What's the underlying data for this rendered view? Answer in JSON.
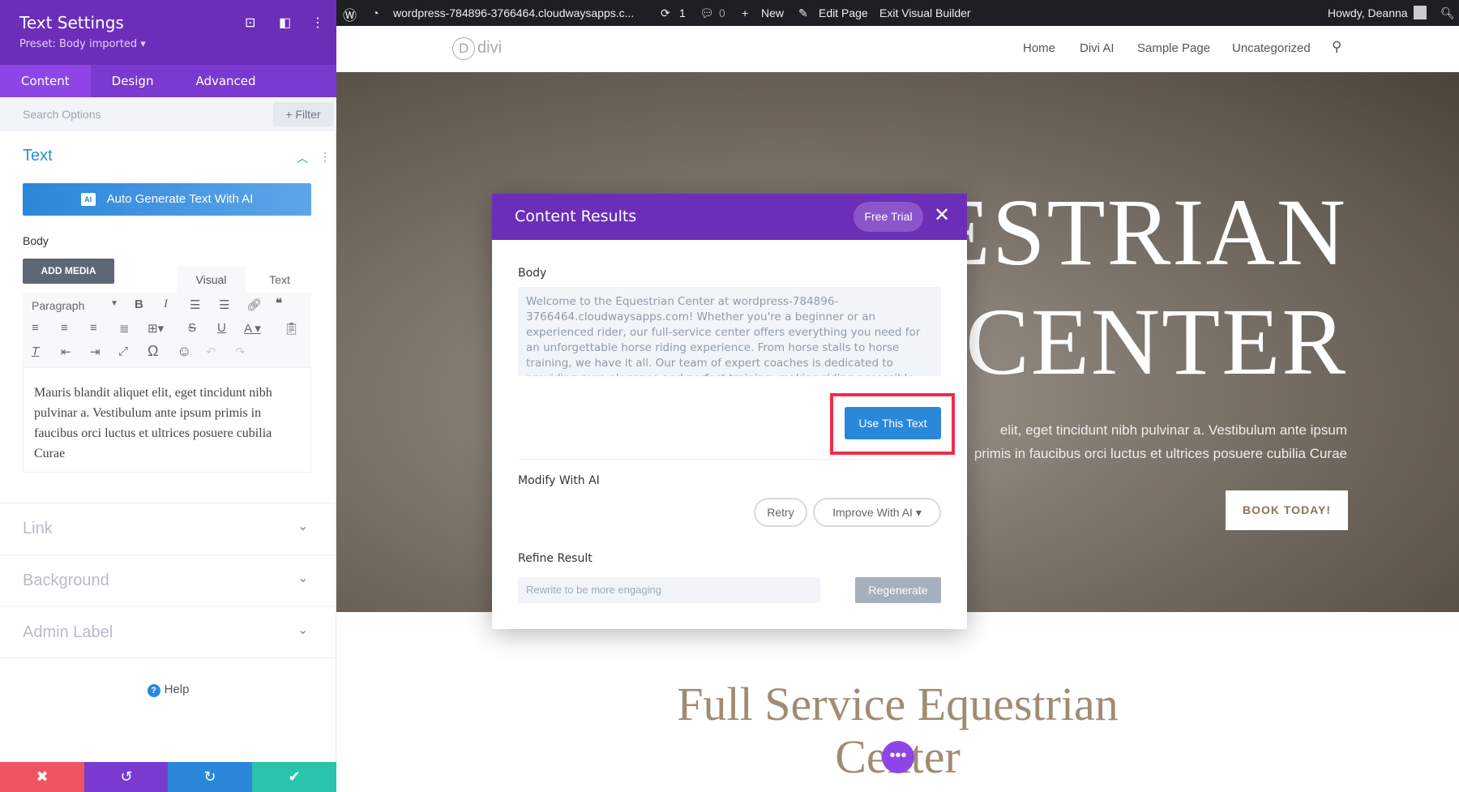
{
  "panel": {
    "title": "Text Settings",
    "preset": "Preset: Body imported ▾",
    "tabs": [
      "Content",
      "Design",
      "Advanced"
    ],
    "search_placeholder": "Search Options",
    "filter": "+ Filter",
    "section": "Text",
    "ai_button": "Auto Generate Text With AI",
    "ai_badge": "AI",
    "body_label": "Body",
    "add_media": "ADD MEDIA",
    "visual_tab": "Visual",
    "text_tab": "Text",
    "format_select": "Paragraph",
    "editor_text": "Mauris blandit aliquet elit, eget tincidunt nibh pulvinar a. Vestibulum ante ipsum primis in faucibus orci luctus et ultrices posuere cubilia Curae",
    "accordions": [
      "Link",
      "Background",
      "Admin Label"
    ],
    "help": "Help"
  },
  "adminbar": {
    "site": "wordpress-784896-3766464.cloudwaysapps.c...",
    "updates": "1",
    "comments": "0",
    "new": "New",
    "edit": "Edit Page",
    "exit": "Exit Visual Builder",
    "howdy": "Howdy, Deanna"
  },
  "nav": {
    "logo": "divi",
    "items": [
      "Home",
      "Divi AI",
      "Sample Page",
      "Uncategorized"
    ]
  },
  "hero": {
    "line1": "ESTRIAN",
    "line2": "CENTER",
    "p1": "elit, eget tincidunt nibh pulvinar a. Vestibulum ante ipsum",
    "p2": "primis in faucibus orci luctus et ultrices posuere cubilia Curae",
    "button": "BOOK TODAY!"
  },
  "section": {
    "line1": "Full Service Equestrian",
    "line2": "Center"
  },
  "modal": {
    "title": "Content Results",
    "trial": "Free Trial",
    "body_label": "Body",
    "body_text": "Welcome to the Equestrian Center at wordpress-784896-3766464.cloudwaysapps.com! Whether you're a beginner or an experienced rider, our full-service center offers everything you need for an unforgettable horse riding experience. From horse stalls to horse training, we have it all. Our team of expert coaches is dedicated to providing pure elegance and perfect training, making riding accessible",
    "use": "Use This Text",
    "modify_label": "Modify With AI",
    "retry": "Retry",
    "improve": "Improve With AI ▾",
    "refine_label": "Refine Result",
    "refine_placeholder": "Rewrite to be more engaging",
    "regenerate": "Regenerate"
  },
  "colors": {
    "purple": "#6c2eb9",
    "blue": "#2b87da",
    "highlight": "#ee2d4a"
  }
}
